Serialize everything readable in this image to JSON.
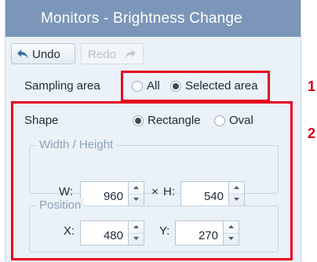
{
  "window": {
    "title": "Monitors - Brightness Change"
  },
  "toolbar": {
    "undo_label": "Undo",
    "redo_label": "Redo"
  },
  "sampling": {
    "label": "Sampling area",
    "options": [
      {
        "label": "All",
        "selected": false
      },
      {
        "label": "Selected area",
        "selected": true
      }
    ]
  },
  "shape": {
    "label": "Shape",
    "options": [
      {
        "label": "Rectangle",
        "selected": true
      },
      {
        "label": "Oval",
        "selected": false
      }
    ]
  },
  "size": {
    "group_title": "Width / Height",
    "w_label": "W:",
    "w_value": "960",
    "separator": "×",
    "h_label": "H:",
    "h_value": "540"
  },
  "position": {
    "group_title": "Position",
    "x_label": "X:",
    "x_value": "480",
    "y_label": "Y:",
    "y_value": "270"
  },
  "annotations": {
    "marker_1": "1",
    "marker_2": "2"
  },
  "colors": {
    "title_bar": "#7b96b8",
    "highlight": "#e8001f",
    "panel": "#eaf1f7"
  }
}
